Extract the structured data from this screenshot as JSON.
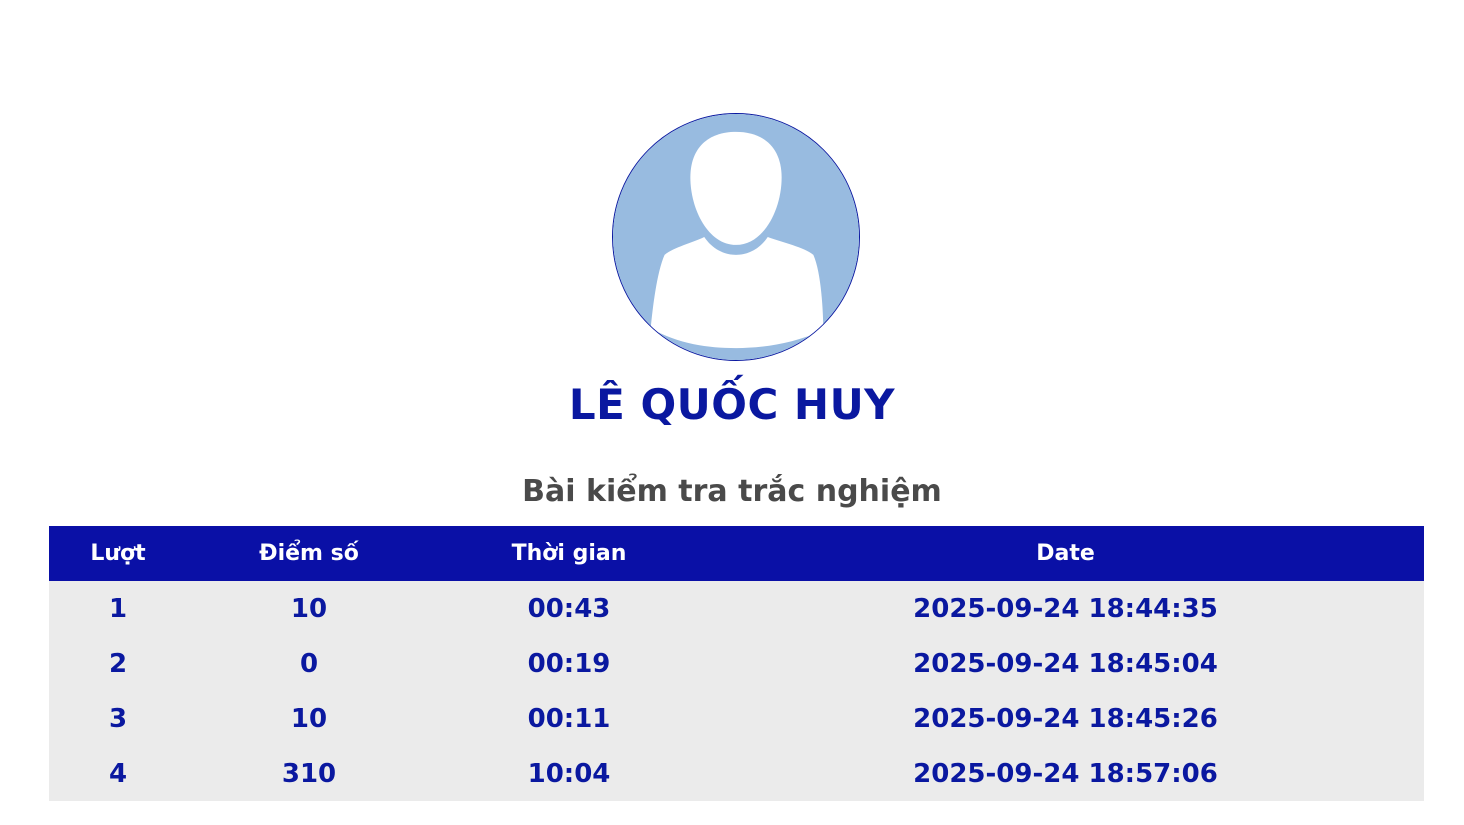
{
  "profile": {
    "avatar_icon": "default-user-avatar-icon",
    "name": "LÊ QUỐC HUY"
  },
  "test": {
    "title": "Bài kiểm tra trắc nghiệm"
  },
  "table": {
    "headers": [
      "Lượt",
      "Điểm số",
      "Thời gian",
      "Date"
    ],
    "rows": [
      [
        "1",
        "10",
        "00:43",
        "2025-09-24 18:44:35"
      ],
      [
        "2",
        "0",
        "00:19",
        "2025-09-24 18:45:04"
      ],
      [
        "3",
        "10",
        "00:11",
        "2025-09-24 18:45:26"
      ],
      [
        "4",
        "310",
        "10:04",
        "2025-09-24 18:57:06"
      ]
    ]
  },
  "colors": {
    "accent": "#0a10a6",
    "text_primary": "#0a18a0",
    "row_background": "#ebebeb",
    "avatar_background": "#98bbe0"
  }
}
